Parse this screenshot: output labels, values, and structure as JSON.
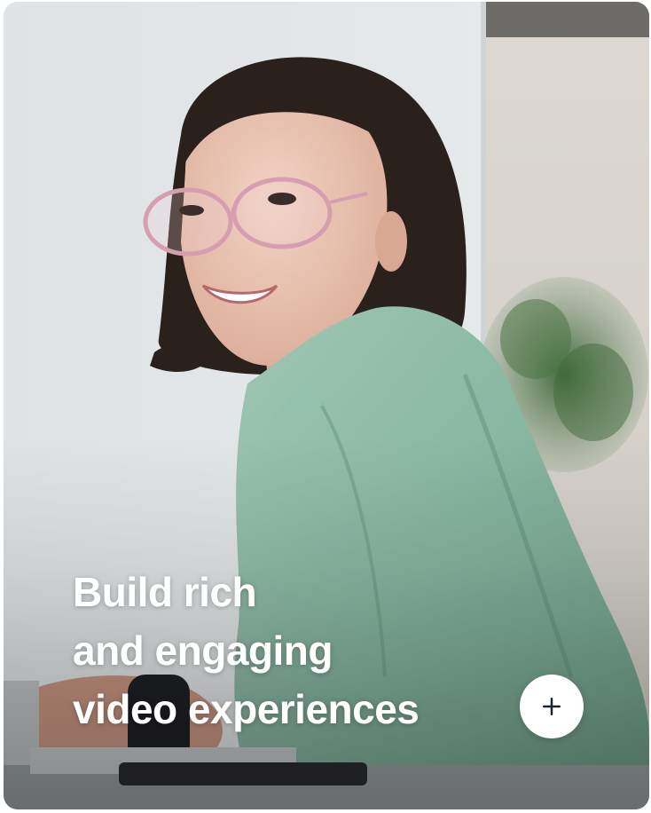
{
  "card": {
    "headline_lines": [
      "Build rich",
      "and engaging",
      "video experiences"
    ],
    "expand_icon": "plus-icon",
    "photo_subject": "smiling-woman-at-laptop"
  },
  "colors": {
    "headline_text": "#ffffff",
    "button_bg": "#ffffff",
    "button_icon": "#1c2430"
  }
}
